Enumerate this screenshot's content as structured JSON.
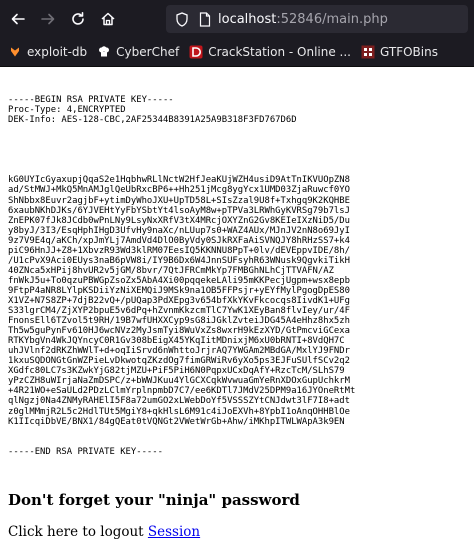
{
  "browser": {
    "url_host": "localhost",
    "url_rest": ":52846/main.php",
    "bookmarks": [
      {
        "label": "exploit-db",
        "icon": "exploit-db-icon"
      },
      {
        "label": "CyberChef",
        "icon": "cyberchef-icon"
      },
      {
        "label": "CrackStation - Online ...",
        "icon": "crackstation-icon"
      },
      {
        "label": "GTFOBins",
        "icon": "gtfobins-icon"
      }
    ]
  },
  "key": {
    "header": [
      "-----BEGIN RSA PRIVATE KEY-----",
      "Proc-Type: 4,ENCRYPTED",
      "DEK-Info: AES-128-CBC,2AF25344B8391A25A9B318F3FD767D6D"
    ],
    "body": [
      "kG0UYIcGyaxupjQqaS2e1HqbhwRLlNctW2HfJeaKUjWZH4usiD9AtTnIKVUOpZN8",
      "ad/StMWJ+MkQ5MnAMJglQeUbRxcBP6++Hh251jMcg8ygYcx1UMD03ZjaRuwcf0YO",
      "ShNbbx8Euvr2agjbF+ytimDyWhoJXU+UpTD58L+SIsZzal9U8f+Txhgq9K2KQHBE",
      "6xaubNKhDJKs/6YJVEHtYyFbYSbtYt4lsoAyM8w+pTPVa3LRWhGyKVRSg79b7lsJ",
      "ZnEPK07fJk8JCdb0wPnLNy9LsyNxXRfV3tX4MRcjOXYZnG2Gv8KEIeIXzNiD5/Du",
      "y8byJ/3I3/EsqHphIHgD3UfvHy9naXc/nLUup7s0+WAZ4AUx/MJnJV2nN8o69JyI",
      "9z7V9E4q/aKCh/xpJmYLj7AmdVd4DlO0ByVdy0SJkRXFaAiSVNQJY8hRHzSS7+k4",
      "piC96HnJJ+Z8+1XbvzR93Wd3klRM07EesIQ5KKNNU8PpT+0lv/dEVEppvIDE/8h/",
      "/U1cPvX9Aci0EUys3naB6pVW8i/IY9B6Dx6W4JnnSUFsyhR63WNusk9QgvkiTikH",
      "40ZNca5xHPij8hvUR2v5jGM/8bvr/7QtJFRCmMkYp7FMBGhNLhCjTTVAFN/AZ",
      "fnWkJ5u+To0qzuPBWGpZsoZx5AbA4Xi00pqqekeLAli95mKKPecjUgpm+wsx8epb",
      "9FtpP4aNR8LYlpKSDiiYzNiXEMQiJ9MSk9na1OB5FFPsjr+yEYfMylPgogDpES80",
      "X1VZ+N7S8ZP+7djB22vQ+/pUQap3PdXEpg3v654bfXkYKvFkcocqs8IivdK1+UFg",
      "S33lgrCM4/ZjXYP2bpuE5v6dPq+hZvnmKkzcmTlC7YwK1XEyBan8flvIey/ur/4F",
      "FnonsEll6TZvol5t9RH/19B7wfUHXXCyp9sG8iJGklZvteiJDG45A4eHhz8hx5zh",
      "Th5w5guPynFv610HJ6wcNVz2MyJsmTyi8WuVxZs8wxrH9kEzXYD/GtPmcviGCexa",
      "RTKYbgVn4WkJQYncyC0R1Gv308bEigX45YKqIitMDnixjM6xU0bRNTI+8VdQH7C",
      "uhJVlnf2dRKZhWWlT+d+oqIiSrvd6nWhttoJrjrAQ7YWGAm2MBdGA/MxlYJ9FNDr",
      "1kxuSQDONGtGnWZPieLvDkwotqZKzdOg7fimGRWiRv6yXo5ps3EJFuSUlfSCv2q2",
      "XGdfc80LC7s3KZwkYjG82tjMZU+PiF5PiH6N0PqpxUCxDqAfY+RzcTcM/SLhS79",
      "yPzCZH8uWIrjaNaZmDSPC/z+bWWJKuu4YlGCXCqkWvwuaGmYeRnXDOxGupUchkrM",
      "+4R21WO+eSaULd2PDzLClmYrplnpmbD7C7/ee6KDTl7JMdV25DPM9a16JYOneRtMt",
      "qlNgzj0Na4ZNMyRAHElI5F8a72umGO2xLWebDoYf5VSSSZYtCNJdwt3lF7I8+adt",
      "z0glMMmjR2L5c2HdlTUt5MgiY8+qkHlsL6M91c4iJoEXVh+8YpbI1oAnqOHHBlOe",
      "K1IIcqiDbVE/BNX1/84gQEat0tVQNGt2VWetWrGb+Ahw/iMKhpITWLWApA3k9EN"
    ],
    "footer": "-----END RSA PRIVATE KEY-----"
  },
  "heading": "Don't forget your \"ninja\" password",
  "logout": {
    "prefix": "Click here to logout ",
    "link": "Session"
  }
}
